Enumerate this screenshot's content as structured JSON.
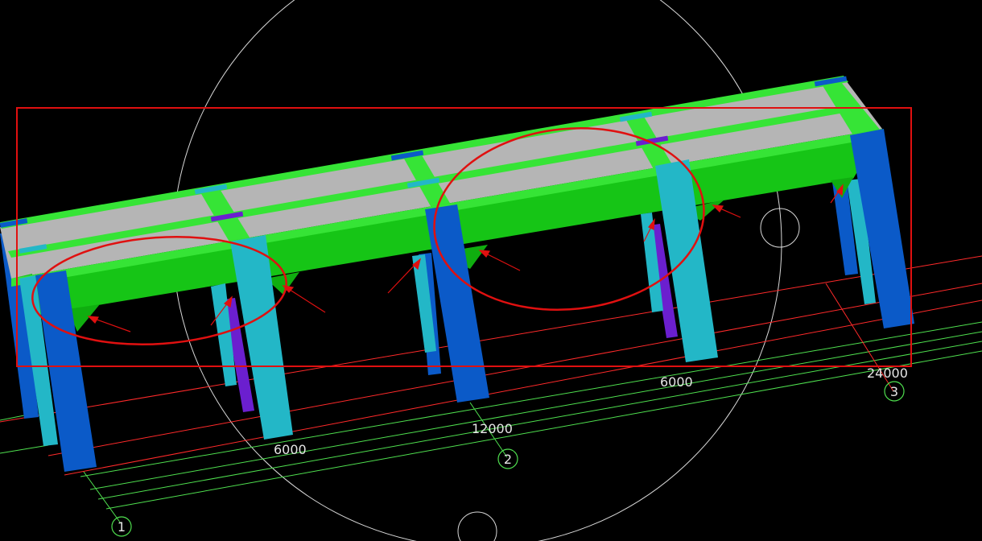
{
  "colors": {
    "background": "#000000",
    "slab": "#b5b5b5",
    "beam": "#16c516",
    "beam_side": "#0fae0f",
    "joint": "#36e436",
    "column_front": "#0b5ac8",
    "column_side": "#23b7c7",
    "brace": "#6b1fcf",
    "grid_red": "#ff2a2a",
    "grid_green": "#4fe04f",
    "annotation": "#e01010",
    "helper_circle": "#d8d8d8"
  },
  "dimensions": {
    "span_a": "6000",
    "total_mid": "12000",
    "span_b": "6000",
    "total_end": "24000"
  },
  "axes": {
    "axis_1": "1",
    "axis_2": "2",
    "axis_3": "3"
  },
  "icons": {
    "annotation_arrow": "red-arrow-icon",
    "highlight_ellipse": "red-ellipse-icon",
    "highlight_box": "red-box-icon"
  }
}
